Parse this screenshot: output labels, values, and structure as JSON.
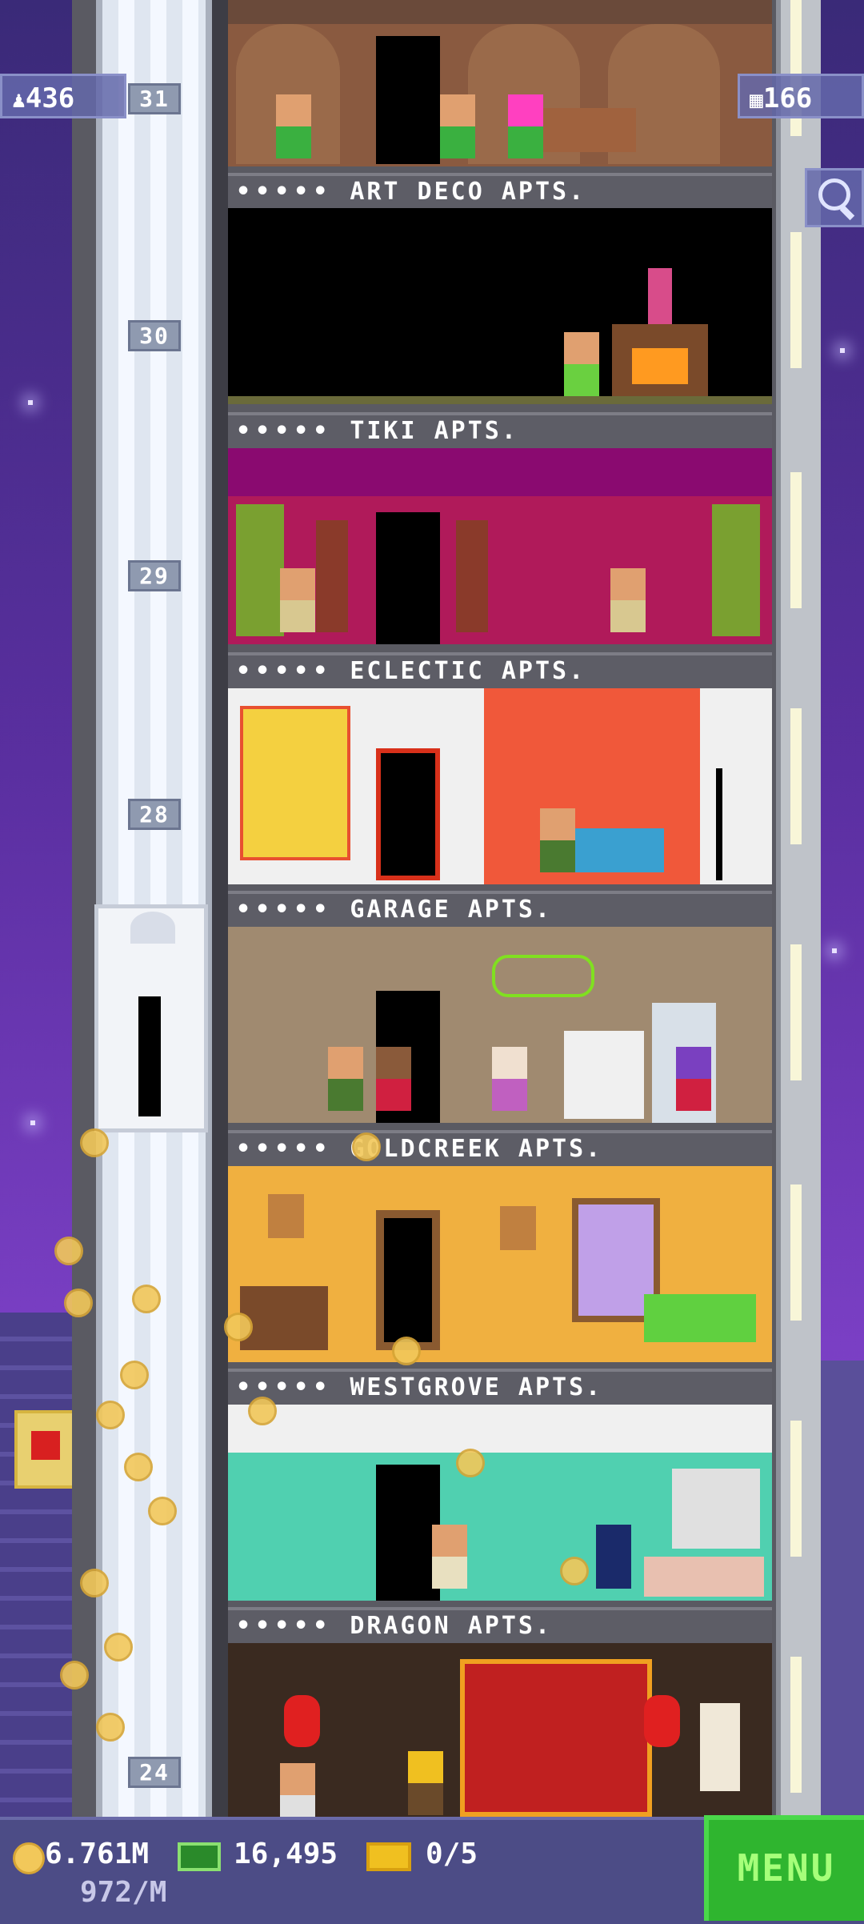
{
  "hud": {
    "population": "436",
    "floors_count": "166",
    "coins": "6.761M",
    "coins_rate": "972/M",
    "bux": "16,495",
    "tickets": "0/5",
    "menu_label": "MENU"
  },
  "floor_numbers": [
    "31",
    "30",
    "29",
    "28",
    "24"
  ],
  "floors": [
    {
      "sign": "ART DECO APTS.",
      "stars": "•••••"
    },
    {
      "sign": "TIKI APTS.",
      "stars": "•••••"
    },
    {
      "sign": "ECLECTIC APTS.",
      "stars": "•••••"
    },
    {
      "sign": "GARAGE APTS.",
      "stars": "•••••"
    },
    {
      "sign": "GOLDCREEK APTS.",
      "stars": "•••••"
    },
    {
      "sign": "WESTGROVE APTS.",
      "stars": "•••••"
    },
    {
      "sign": "DRAGON APTS.",
      "stars": "•••••"
    }
  ],
  "colors": {
    "sky": "#5a2fa0",
    "menu_green": "#2fb52f",
    "coin_gold": "#f2c85a"
  },
  "icons": [
    "person-icon",
    "building-icon",
    "magnifier-icon",
    "coin-icon",
    "bux-icon",
    "ticket-icon"
  ]
}
